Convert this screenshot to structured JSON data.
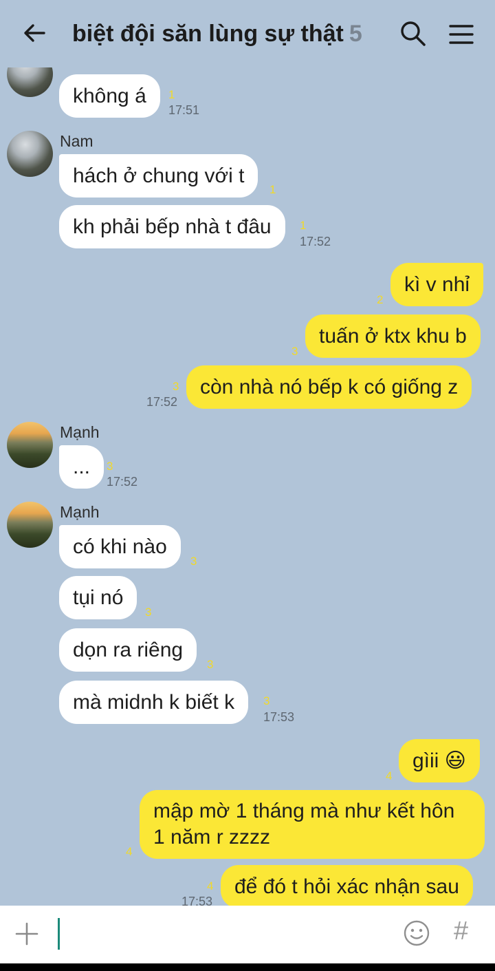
{
  "header": {
    "title": "biệt đội săn lùng sự thật",
    "member_count": "5",
    "back_icon": "arrow-left-icon",
    "search_icon": "search-icon",
    "menu_icon": "hamburger-menu-icon"
  },
  "messages": [
    {
      "text": "không á",
      "read": "1",
      "time": "17:51"
    },
    {
      "sender": "Nam"
    },
    {
      "text": "hách ở chung với t",
      "read": "1"
    },
    {
      "text": "kh phải bếp nhà t đâu",
      "read": "1",
      "time": "17:52"
    },
    {
      "text": "kì v nhỉ",
      "read": "2"
    },
    {
      "text": "tuấn ở ktx khu b",
      "read": "3"
    },
    {
      "text": "còn nhà nó bếp k có giống z",
      "read": "3",
      "time": "17:52"
    },
    {
      "sender": "Mạnh"
    },
    {
      "text": "...",
      "read": "3",
      "time": "17:52"
    },
    {
      "sender": "Mạnh"
    },
    {
      "text": "có khi nào",
      "read": "3"
    },
    {
      "text": "tụi nó",
      "read": "3"
    },
    {
      "text": "dọn ra riêng",
      "read": "3"
    },
    {
      "text": "mà midnh k biết k",
      "read": "3",
      "time": "17:53"
    },
    {
      "text": "gìii 😃",
      "read": "4"
    },
    {
      "text": "mập mờ 1 tháng mà như kết hôn 1 năm r zzzz",
      "read": "4"
    },
    {
      "text": "để đó t hỏi xác nhận sau",
      "read": "4",
      "time": "17:53"
    }
  ],
  "input": {
    "plus_icon": "plus-icon",
    "emoji_icon": "emoji-icon",
    "hash_label": "#"
  },
  "colors": {
    "background": "#b1c4d8",
    "outgoing_bubble": "#fbe736",
    "incoming_bubble": "#ffffff",
    "read_count": "#f1d92a"
  }
}
